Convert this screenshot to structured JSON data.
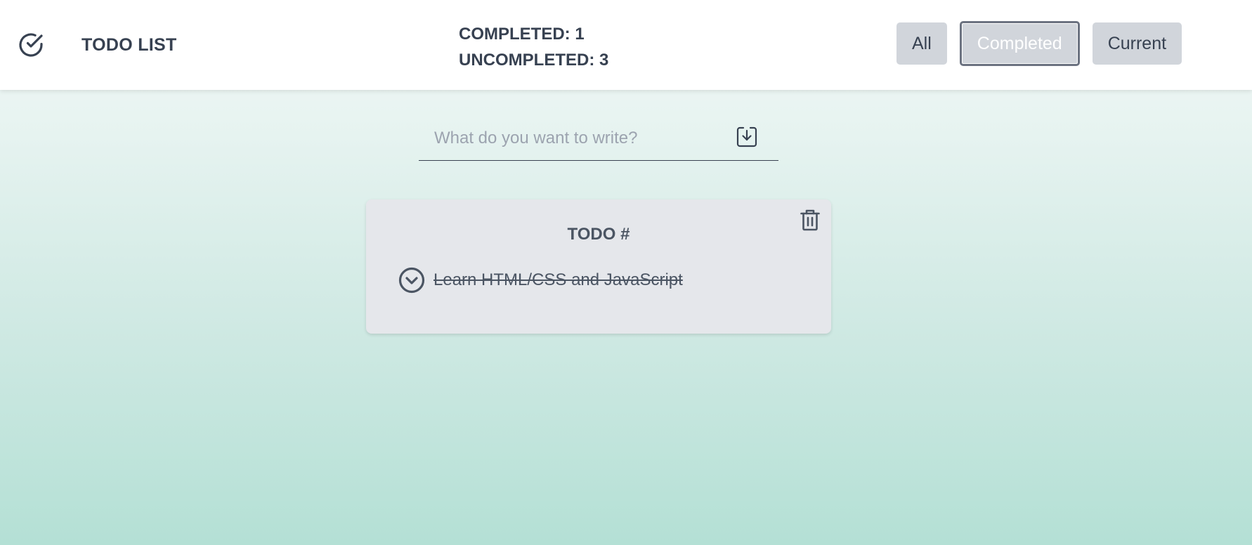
{
  "header": {
    "title": "TODO LIST",
    "logo_icon": "check-circle-icon"
  },
  "stats": {
    "completed_label": "COMPLETED: 1",
    "uncompleted_label": "UNCOMPLETED: 3"
  },
  "filters": {
    "items": [
      {
        "label": "All",
        "active": false
      },
      {
        "label": "Completed",
        "active": true
      },
      {
        "label": "Current",
        "active": false
      }
    ]
  },
  "input": {
    "value": "",
    "placeholder": "What do you want to write?",
    "submit_icon": "download-box-icon"
  },
  "card": {
    "title": "TODO #",
    "delete_icon": "trash-icon",
    "items": [
      {
        "text": "Learn HTML/CSS and JavaScript",
        "completed": true,
        "toggle_icon": "chevron-circle-icon"
      }
    ]
  },
  "colors": {
    "text": "#374151",
    "button_bg": "#d1d5db",
    "card_bg": "#e5e7eb",
    "gradient_top": "#f3f8f7",
    "gradient_bottom": "#b4e0d5"
  }
}
